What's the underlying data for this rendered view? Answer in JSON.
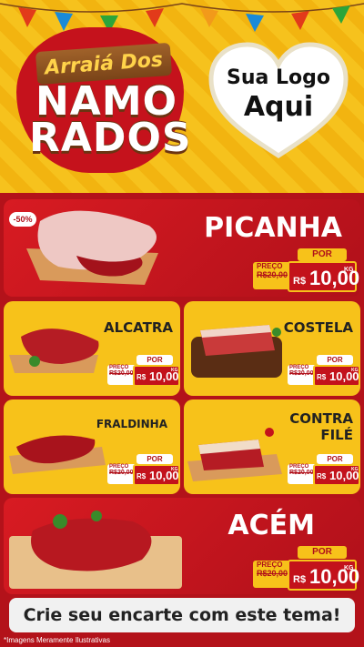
{
  "header": {
    "brand_top": "Arraiá Dos",
    "brand_line1": "NAMO",
    "brand_line2": "RADOS",
    "logo_line1": "Sua Logo",
    "logo_line2": "Aqui"
  },
  "products": [
    {
      "name": "PICANHA",
      "badge": "-50%",
      "por": "POR",
      "preco": "PREÇO",
      "old": "R$20,00",
      "currency": "R$",
      "price": "10,00",
      "unit": "KG"
    },
    {
      "name": "ALCATRA",
      "por": "POR",
      "preco": "PREÇO",
      "old": "R$20,00",
      "currency": "R$",
      "price": "10,00",
      "unit": "KG"
    },
    {
      "name": "COSTELA",
      "por": "POR",
      "preco": "PREÇO",
      "old": "R$20,00",
      "currency": "R$",
      "price": "10,00",
      "unit": "KG"
    },
    {
      "name": "FRALDINHA",
      "por": "POR",
      "preco": "PREÇO",
      "old": "R$20,00",
      "currency": "R$",
      "price": "10,00",
      "unit": "KG"
    },
    {
      "name_line1": "CONTRA",
      "name_line2": "FILÉ",
      "por": "POR",
      "preco": "PREÇO",
      "old": "R$20,00",
      "currency": "R$",
      "price": "10,00",
      "unit": "KG"
    },
    {
      "name": "ACÉM",
      "por": "POR",
      "preco": "PREÇO",
      "old": "R$20,00",
      "currency": "R$",
      "price": "10,00",
      "unit": "KG"
    }
  ],
  "footer": {
    "cta": "Crie seu encarte com este tema!",
    "note": "*Imagens Meramente Ilustrativas"
  },
  "colors": {
    "red": "#c3121b",
    "yellow": "#f7c21a"
  }
}
